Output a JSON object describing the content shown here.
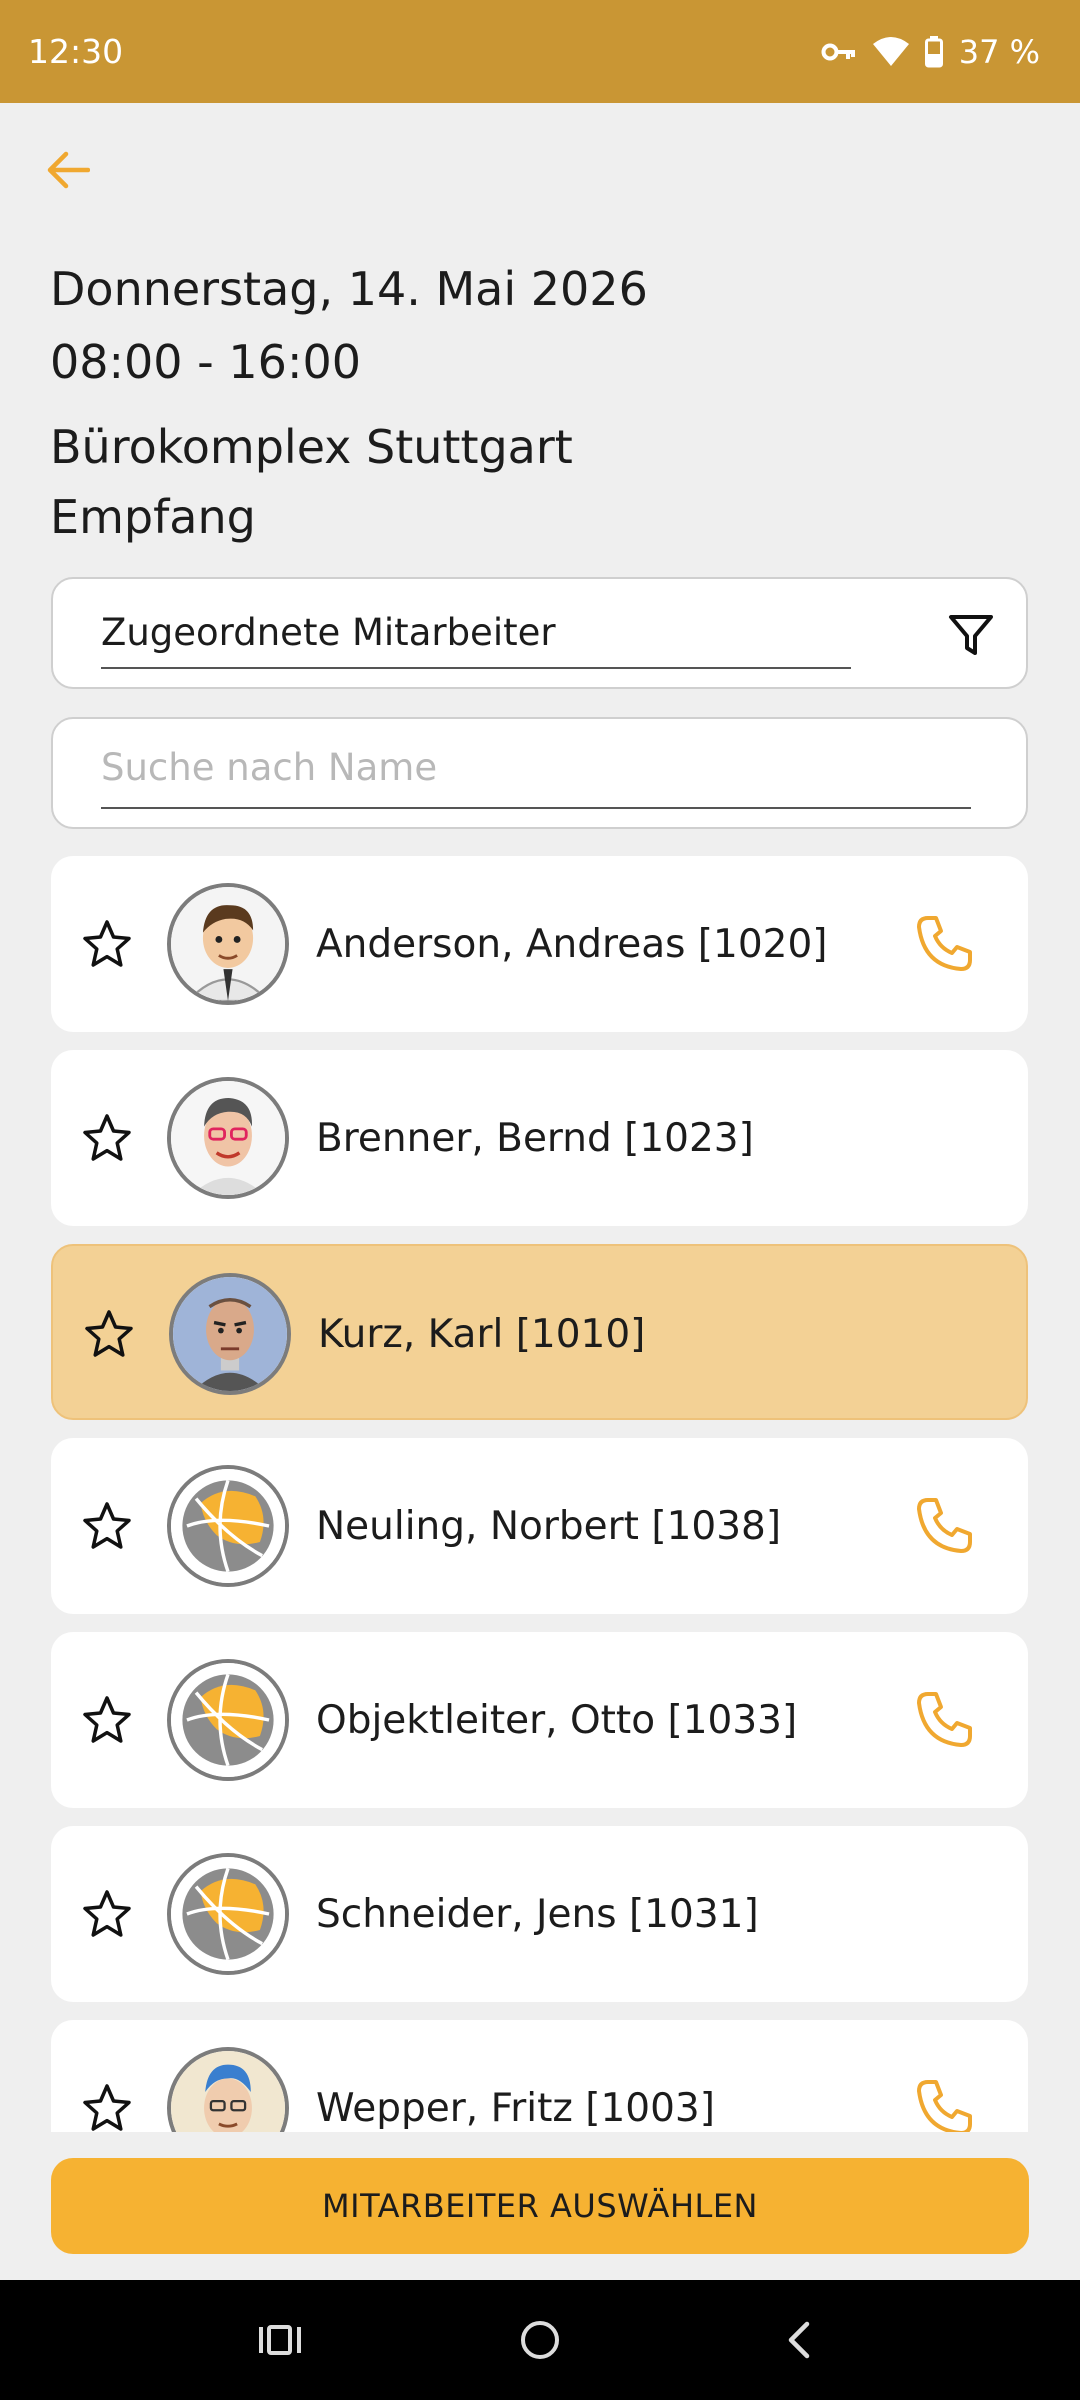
{
  "status_bar": {
    "time": "12:30",
    "battery": "37 %"
  },
  "header": {
    "date": "Donnerstag, 14. Mai 2026",
    "time_range": "08:00 - 16:00",
    "location": "Bürokomplex Stuttgart",
    "area": "Empfang"
  },
  "filter": {
    "value": "Zugeordnete Mitarbeiter"
  },
  "search": {
    "placeholder": "Suche nach Name"
  },
  "employees": [
    {
      "name": "Anderson, Andreas [1020]",
      "avatar": "cartoon-man-avatar",
      "has_phone": true,
      "selected": false
    },
    {
      "name": "Brenner, Bernd [1023]",
      "avatar": "cartoon-glasses-avatar",
      "has_phone": false,
      "selected": false
    },
    {
      "name": "Kurz, Karl [1010]",
      "avatar": "cartoon-bald-man-avatar",
      "has_phone": false,
      "selected": true
    },
    {
      "name": "Neuling, Norbert [1038]",
      "avatar": "default-globe-avatar",
      "has_phone": true,
      "selected": false
    },
    {
      "name": "Objektleiter, Otto [1033]",
      "avatar": "default-globe-avatar",
      "has_phone": true,
      "selected": false
    },
    {
      "name": "Schneider, Jens [1031]",
      "avatar": "default-globe-avatar",
      "has_phone": false,
      "selected": false
    },
    {
      "name": "Wepper, Fritz [1003]",
      "avatar": "cartoon-blue-hair-avatar",
      "has_phone": true,
      "selected": false
    }
  ],
  "actions": {
    "select_label": "MITARBEITER AUSWÄHLEN"
  },
  "colors": {
    "status_bar": "#c99634",
    "accent": "#f6b232",
    "selected_row": "#f3d195",
    "background": "#efefef"
  }
}
